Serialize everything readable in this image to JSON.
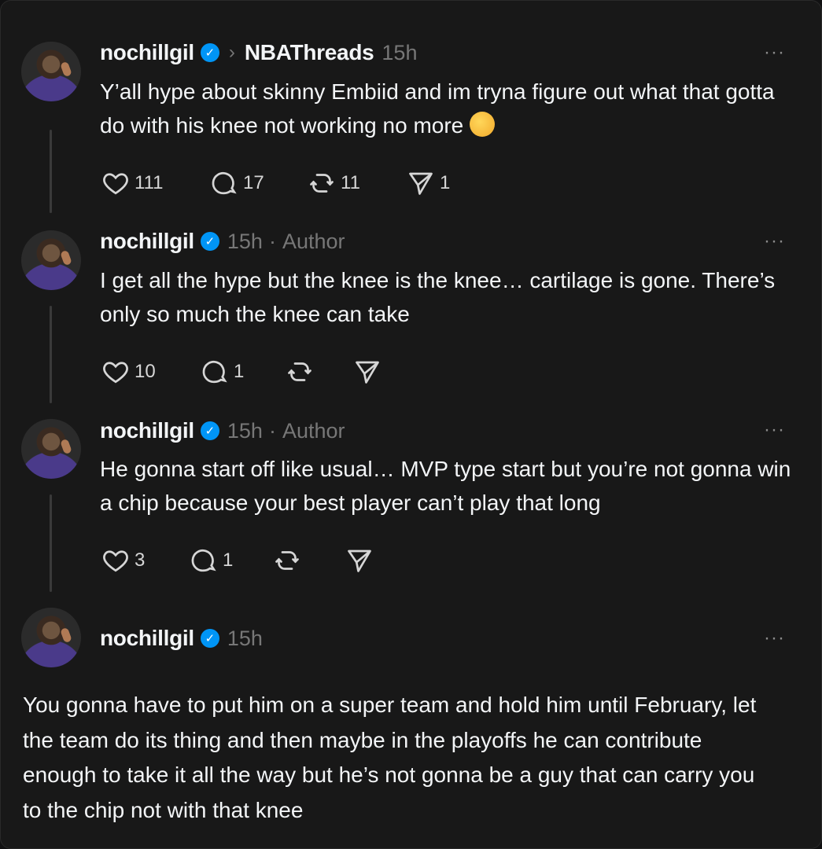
{
  "thread": {
    "posts": [
      {
        "username": "nochillgil",
        "verified_mark": "✓",
        "community_chevron": "›",
        "community": "NBAThreads",
        "time": "15h",
        "author_label": "",
        "text": "Y’all hype about skinny Embiid and im tryna figure out what that gotta do with his knee not working no more",
        "emoji": "flushed-face",
        "likes": "111",
        "replies": "17",
        "reposts": "11",
        "shares": "1",
        "more": "···"
      },
      {
        "username": "nochillgil",
        "verified_mark": "✓",
        "time": "15h",
        "separator": "·",
        "author_label": "Author",
        "text": "I get all the hype but the knee is the knee… cartilage is gone. There’s only so much the knee can take",
        "likes": "10",
        "replies": "1",
        "reposts": "",
        "shares": "",
        "more": "···"
      },
      {
        "username": "nochillgil",
        "verified_mark": "✓",
        "time": "15h",
        "separator": "·",
        "author_label": "Author",
        "text": "He gonna start off like usual… MVP type start but you’re not gonna win a chip because your best player can’t play that long",
        "likes": "3",
        "replies": "1",
        "reposts": "",
        "shares": "",
        "more": "···"
      },
      {
        "username": "nochillgil",
        "verified_mark": "✓",
        "time": "15h",
        "text": "You gonna have to put him on a super team and hold him until February, let the team do its thing and then maybe in the playoffs he can contribute enough to take it all the way but he’s not gonna be a guy that can carry you to the chip not with that knee",
        "more": "···"
      }
    ]
  },
  "colors": {
    "background": "#181818",
    "text": "#f3f5f7",
    "muted": "#777777",
    "verified": "#0095f6"
  },
  "icons": {
    "like": "heart-icon",
    "reply": "comment-icon",
    "repost": "repost-icon",
    "share": "send-icon",
    "more": "more-icon"
  }
}
